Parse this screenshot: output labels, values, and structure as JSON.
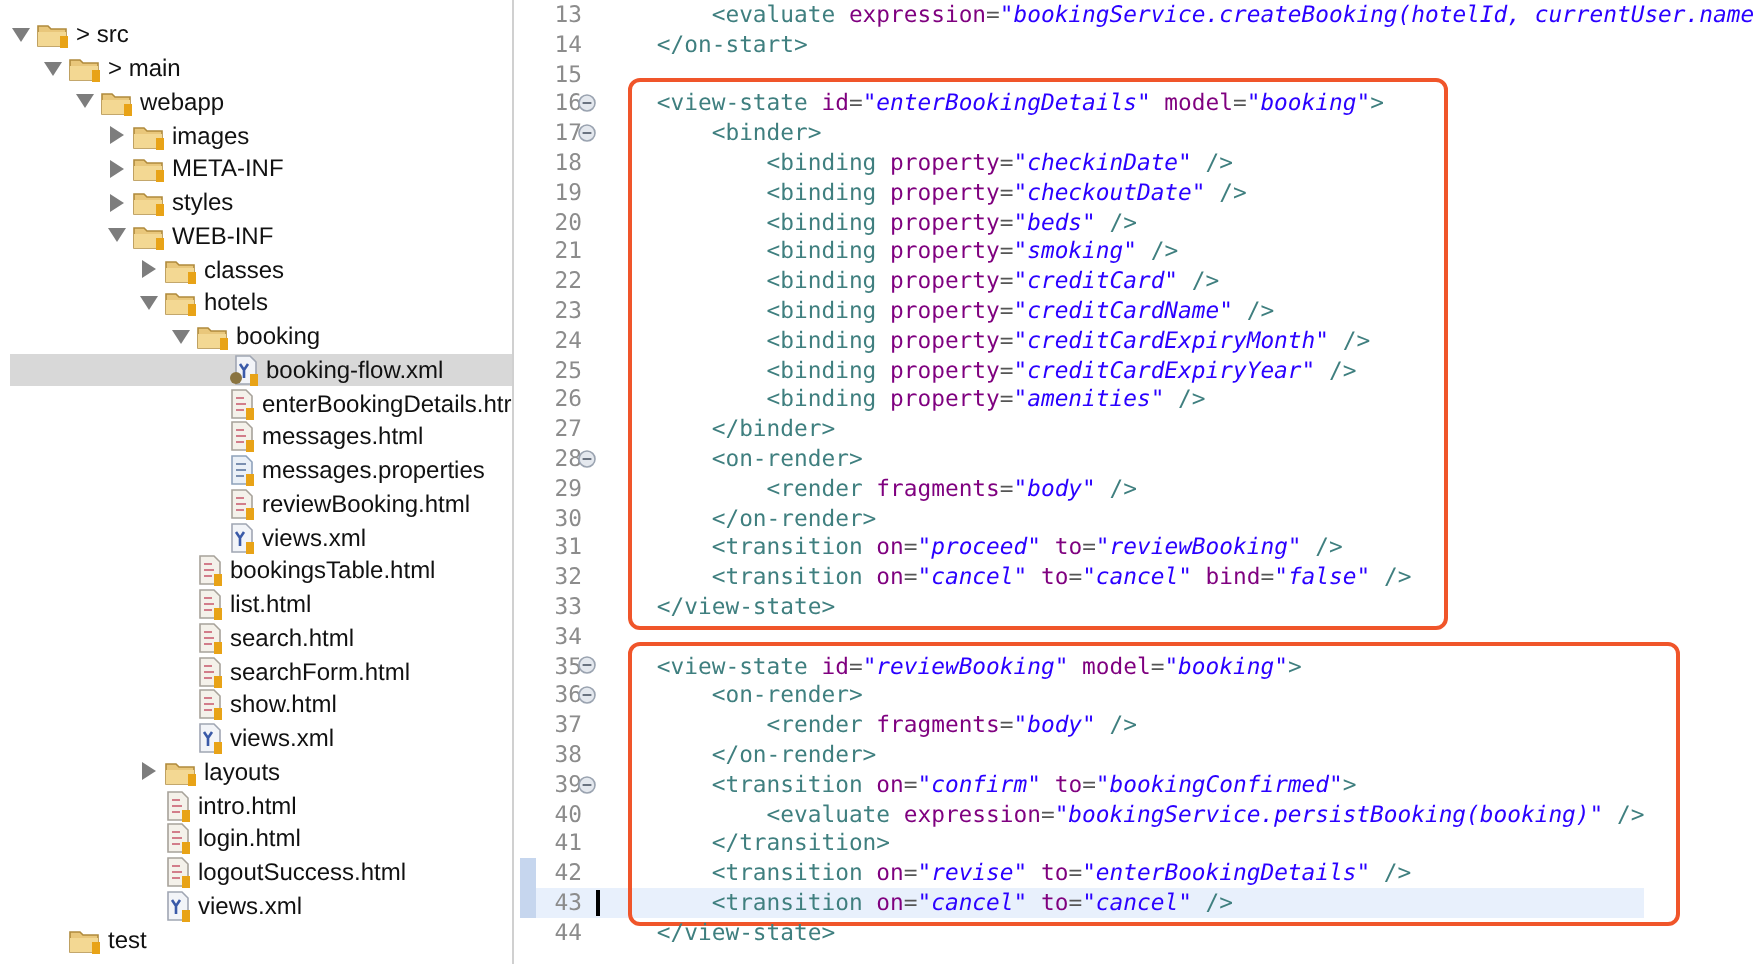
{
  "project_tree": [
    {
      "label": "> src",
      "kind": "folder",
      "expanded": true,
      "selected": false,
      "children": [
        {
          "label": "> main",
          "kind": "folder",
          "expanded": true,
          "selected": false,
          "children": [
            {
              "label": "webapp",
              "kind": "folder",
              "expanded": true,
              "selected": false,
              "children": [
                {
                  "label": "images",
                  "kind": "folder",
                  "expanded": false,
                  "selected": false
                },
                {
                  "label": "META-INF",
                  "kind": "folder",
                  "expanded": false,
                  "selected": false
                },
                {
                  "label": "styles",
                  "kind": "folder",
                  "expanded": false,
                  "selected": false
                },
                {
                  "label": "WEB-INF",
                  "kind": "folder",
                  "expanded": true,
                  "selected": false,
                  "children": [
                    {
                      "label": "classes",
                      "kind": "folder",
                      "expanded": false,
                      "selected": false
                    },
                    {
                      "label": "hotels",
                      "kind": "folder",
                      "expanded": true,
                      "selected": false,
                      "children": [
                        {
                          "label": "booking",
                          "kind": "folder",
                          "expanded": true,
                          "selected": false,
                          "children": [
                            {
                              "label": "booking-flow.xml",
                              "kind": "flow",
                              "selected": true
                            },
                            {
                              "label": "enterBookingDetails.htr",
                              "kind": "html",
                              "selected": false
                            },
                            {
                              "label": "messages.html",
                              "kind": "html",
                              "selected": false
                            },
                            {
                              "label": "messages.properties",
                              "kind": "properties",
                              "selected": false
                            },
                            {
                              "label": "reviewBooking.html",
                              "kind": "html",
                              "selected": false
                            },
                            {
                              "label": "views.xml",
                              "kind": "xml",
                              "selected": false
                            }
                          ]
                        },
                        {
                          "label": "bookingsTable.html",
                          "kind": "html",
                          "selected": false
                        },
                        {
                          "label": "list.html",
                          "kind": "html",
                          "selected": false
                        },
                        {
                          "label": "search.html",
                          "kind": "html",
                          "selected": false
                        },
                        {
                          "label": "searchForm.html",
                          "kind": "html",
                          "selected": false
                        },
                        {
                          "label": "show.html",
                          "kind": "html",
                          "selected": false
                        },
                        {
                          "label": "views.xml",
                          "kind": "xml",
                          "selected": false
                        }
                      ]
                    },
                    {
                      "label": "layouts",
                      "kind": "folder",
                      "expanded": false,
                      "selected": false
                    },
                    {
                      "label": "intro.html",
                      "kind": "html",
                      "selected": false
                    },
                    {
                      "label": "login.html",
                      "kind": "html",
                      "selected": false
                    },
                    {
                      "label": "logoutSuccess.html",
                      "kind": "html",
                      "selected": false
                    },
                    {
                      "label": "views.xml",
                      "kind": "xml",
                      "selected": false
                    }
                  ]
                }
              ]
            }
          ]
        },
        {
          "label": "test",
          "kind": "folder",
          "selected": false
        }
      ]
    }
  ],
  "editor": {
    "blocks": [
      {
        "highlighted": false,
        "lines": [
          {
            "number": "13",
            "fold": false,
            "code": [
              {
                "kind": "tag",
                "text": "        <evaluate"
              },
              {
                "kind": "attr",
                "text": " expression"
              },
              {
                "kind": "eq",
                "text": "="
              },
              {
                "kind": "val",
                "text": "\"bookingService.createBooking(hotelId, currentUser.name"
              }
            ]
          },
          {
            "number": "14",
            "fold": false,
            "code": [
              {
                "kind": "tag",
                "text": "    </on-start>"
              }
            ]
          },
          {
            "number": "15",
            "fold": false
          }
        ]
      },
      {
        "highlighted": true,
        "lines": [
          {
            "number": "16",
            "fold": true,
            "code": [
              {
                "kind": "tag",
                "text": "    <view-state"
              },
              {
                "kind": "attr",
                "text": " id"
              },
              {
                "kind": "eq",
                "text": "="
              },
              {
                "kind": "val",
                "text": "\"enterBookingDetails\""
              },
              {
                "kind": "attr",
                "text": " model"
              },
              {
                "kind": "eq",
                "text": "="
              },
              {
                "kind": "val",
                "text": "\"booking\""
              },
              {
                "kind": "tag",
                "text": ">"
              }
            ]
          },
          {
            "number": "17",
            "fold": true,
            "code": [
              {
                "kind": "tag",
                "text": "        <binder>"
              }
            ]
          },
          {
            "number": "18",
            "fold": false,
            "code": [
              {
                "kind": "tag",
                "text": "            <binding"
              },
              {
                "kind": "attr",
                "text": " property"
              },
              {
                "kind": "eq",
                "text": "="
              },
              {
                "kind": "val",
                "text": "\"checkinDate\""
              },
              {
                "kind": "tag",
                "text": " />"
              }
            ]
          },
          {
            "number": "19",
            "fold": false,
            "code": [
              {
                "kind": "tag",
                "text": "            <binding"
              },
              {
                "kind": "attr",
                "text": " property"
              },
              {
                "kind": "eq",
                "text": "="
              },
              {
                "kind": "val",
                "text": "\"checkoutDate\""
              },
              {
                "kind": "tag",
                "text": " />"
              }
            ]
          },
          {
            "number": "20",
            "fold": false,
            "code": [
              {
                "kind": "tag",
                "text": "            <binding"
              },
              {
                "kind": "attr",
                "text": " property"
              },
              {
                "kind": "eq",
                "text": "="
              },
              {
                "kind": "val",
                "text": "\"beds\""
              },
              {
                "kind": "tag",
                "text": " />"
              }
            ]
          },
          {
            "number": "21",
            "fold": false,
            "code": [
              {
                "kind": "tag",
                "text": "            <binding"
              },
              {
                "kind": "attr",
                "text": " property"
              },
              {
                "kind": "eq",
                "text": "="
              },
              {
                "kind": "val",
                "text": "\"smoking\""
              },
              {
                "kind": "tag",
                "text": " />"
              }
            ]
          },
          {
            "number": "22",
            "fold": false,
            "code": [
              {
                "kind": "tag",
                "text": "            <binding"
              },
              {
                "kind": "attr",
                "text": " property"
              },
              {
                "kind": "eq",
                "text": "="
              },
              {
                "kind": "val",
                "text": "\"creditCard\""
              },
              {
                "kind": "tag",
                "text": " />"
              }
            ]
          },
          {
            "number": "23",
            "fold": false,
            "code": [
              {
                "kind": "tag",
                "text": "            <binding"
              },
              {
                "kind": "attr",
                "text": " property"
              },
              {
                "kind": "eq",
                "text": "="
              },
              {
                "kind": "val",
                "text": "\"creditCardName\""
              },
              {
                "kind": "tag",
                "text": " />"
              }
            ]
          },
          {
            "number": "24",
            "fold": false,
            "code": [
              {
                "kind": "tag",
                "text": "            <binding"
              },
              {
                "kind": "attr",
                "text": " property"
              },
              {
                "kind": "eq",
                "text": "="
              },
              {
                "kind": "val",
                "text": "\"creditCardExpiryMonth\""
              },
              {
                "kind": "tag",
                "text": " />"
              }
            ]
          },
          {
            "number": "25",
            "fold": false,
            "code": [
              {
                "kind": "tag",
                "text": "            <binding"
              },
              {
                "kind": "attr",
                "text": " property"
              },
              {
                "kind": "eq",
                "text": "="
              },
              {
                "kind": "val",
                "text": "\"creditCardExpiryYear\""
              },
              {
                "kind": "tag",
                "text": " />"
              }
            ]
          },
          {
            "number": "26",
            "fold": false,
            "code": [
              {
                "kind": "tag",
                "text": "            <binding"
              },
              {
                "kind": "attr",
                "text": " property"
              },
              {
                "kind": "eq",
                "text": "="
              },
              {
                "kind": "val",
                "text": "\"amenities\""
              },
              {
                "kind": "tag",
                "text": " />"
              }
            ]
          },
          {
            "number": "27",
            "fold": false,
            "code": [
              {
                "kind": "tag",
                "text": "        </binder>"
              }
            ]
          },
          {
            "number": "28",
            "fold": true,
            "code": [
              {
                "kind": "tag",
                "text": "        <on-render>"
              }
            ]
          },
          {
            "number": "29",
            "fold": false,
            "code": [
              {
                "kind": "tag",
                "text": "            <render"
              },
              {
                "kind": "attr",
                "text": " fragments"
              },
              {
                "kind": "eq",
                "text": "="
              },
              {
                "kind": "val",
                "text": "\"body\""
              },
              {
                "kind": "tag",
                "text": " />"
              }
            ]
          },
          {
            "number": "30",
            "fold": false,
            "code": [
              {
                "kind": "tag",
                "text": "        </on-render>"
              }
            ]
          },
          {
            "number": "31",
            "fold": false,
            "code": [
              {
                "kind": "tag",
                "text": "        <transition"
              },
              {
                "kind": "attr",
                "text": " on"
              },
              {
                "kind": "eq",
                "text": "="
              },
              {
                "kind": "val",
                "text": "\"proceed\""
              },
              {
                "kind": "attr",
                "text": " to"
              },
              {
                "kind": "eq",
                "text": "="
              },
              {
                "kind": "val",
                "text": "\"reviewBooking\""
              },
              {
                "kind": "tag",
                "text": " />"
              }
            ]
          },
          {
            "number": "32",
            "fold": false,
            "code": [
              {
                "kind": "tag",
                "text": "        <transition"
              },
              {
                "kind": "attr",
                "text": " on"
              },
              {
                "kind": "eq",
                "text": "="
              },
              {
                "kind": "val",
                "text": "\"cancel\""
              },
              {
                "kind": "attr",
                "text": " to"
              },
              {
                "kind": "eq",
                "text": "="
              },
              {
                "kind": "val",
                "text": "\"cancel\""
              },
              {
                "kind": "attr",
                "text": " bind"
              },
              {
                "kind": "eq",
                "text": "="
              },
              {
                "kind": "val",
                "text": "\"false\""
              },
              {
                "kind": "tag",
                "text": " />"
              }
            ]
          },
          {
            "number": "33",
            "fold": false,
            "code": [
              {
                "kind": "tag",
                "text": "    </view-state>"
              }
            ]
          }
        ]
      },
      {
        "highlighted": false,
        "lines": [
          {
            "number": "34",
            "fold": false
          }
        ]
      },
      {
        "highlighted": true,
        "lines": [
          {
            "number": "35",
            "fold": true,
            "code": [
              {
                "kind": "tag",
                "text": "    <view-state"
              },
              {
                "kind": "attr",
                "text": " id"
              },
              {
                "kind": "eq",
                "text": "="
              },
              {
                "kind": "val",
                "text": "\"reviewBooking\""
              },
              {
                "kind": "attr",
                "text": " model"
              },
              {
                "kind": "eq",
                "text": "="
              },
              {
                "kind": "val",
                "text": "\"booking\""
              },
              {
                "kind": "tag",
                "text": ">"
              }
            ]
          },
          {
            "number": "36",
            "fold": true,
            "code": [
              {
                "kind": "tag",
                "text": "        <on-render>"
              }
            ]
          },
          {
            "number": "37",
            "fold": false,
            "code": [
              {
                "kind": "tag",
                "text": "            <render"
              },
              {
                "kind": "attr",
                "text": " fragments"
              },
              {
                "kind": "eq",
                "text": "="
              },
              {
                "kind": "val",
                "text": "\"body\""
              },
              {
                "kind": "tag",
                "text": " />"
              }
            ]
          },
          {
            "number": "38",
            "fold": false,
            "code": [
              {
                "kind": "tag",
                "text": "        </on-render>"
              }
            ]
          },
          {
            "number": "39",
            "fold": true,
            "code": [
              {
                "kind": "tag",
                "text": "        <transition"
              },
              {
                "kind": "attr",
                "text": " on"
              },
              {
                "kind": "eq",
                "text": "="
              },
              {
                "kind": "val",
                "text": "\"confirm\""
              },
              {
                "kind": "attr",
                "text": " to"
              },
              {
                "kind": "eq",
                "text": "="
              },
              {
                "kind": "val",
                "text": "\"bookingConfirmed\""
              },
              {
                "kind": "tag",
                "text": ">"
              }
            ]
          },
          {
            "number": "40",
            "fold": false,
            "code": [
              {
                "kind": "tag",
                "text": "            <evaluate"
              },
              {
                "kind": "attr",
                "text": " expression"
              },
              {
                "kind": "eq",
                "text": "="
              },
              {
                "kind": "val",
                "text": "\"bookingService.persistBooking(booking)\""
              },
              {
                "kind": "tag",
                "text": " />"
              }
            ]
          },
          {
            "number": "41",
            "fold": false,
            "code": [
              {
                "kind": "tag",
                "text": "        </transition>"
              }
            ]
          },
          {
            "number": "42",
            "fold": false,
            "marked": true,
            "code": [
              {
                "kind": "tag",
                "text": "        <transition"
              },
              {
                "kind": "attr",
                "text": " on"
              },
              {
                "kind": "eq",
                "text": "="
              },
              {
                "kind": "val",
                "text": "\"revise\""
              },
              {
                "kind": "attr",
                "text": " to"
              },
              {
                "kind": "eq",
                "text": "="
              },
              {
                "kind": "val",
                "text": "\"enterBookingDetails\""
              },
              {
                "kind": "tag",
                "text": " />"
              }
            ]
          },
          {
            "number": "43",
            "fold": false,
            "marked": true,
            "current": true,
            "code": [
              {
                "kind": "tag",
                "text": "        <transition"
              },
              {
                "kind": "attr",
                "text": " on"
              },
              {
                "kind": "eq",
                "text": "="
              },
              {
                "kind": "val",
                "text": "\"cancel\""
              },
              {
                "kind": "attr",
                "text": " to"
              },
              {
                "kind": "eq",
                "text": "="
              },
              {
                "kind": "val",
                "text": "\"cancel\""
              },
              {
                "kind": "tag",
                "text": " />"
              }
            ]
          }
        ]
      },
      {
        "highlighted": false,
        "lines": [
          {
            "number": "44",
            "fold": false,
            "code": [
              {
                "kind": "tag",
                "text": "    </view-state>"
              }
            ]
          }
        ]
      }
    ]
  }
}
